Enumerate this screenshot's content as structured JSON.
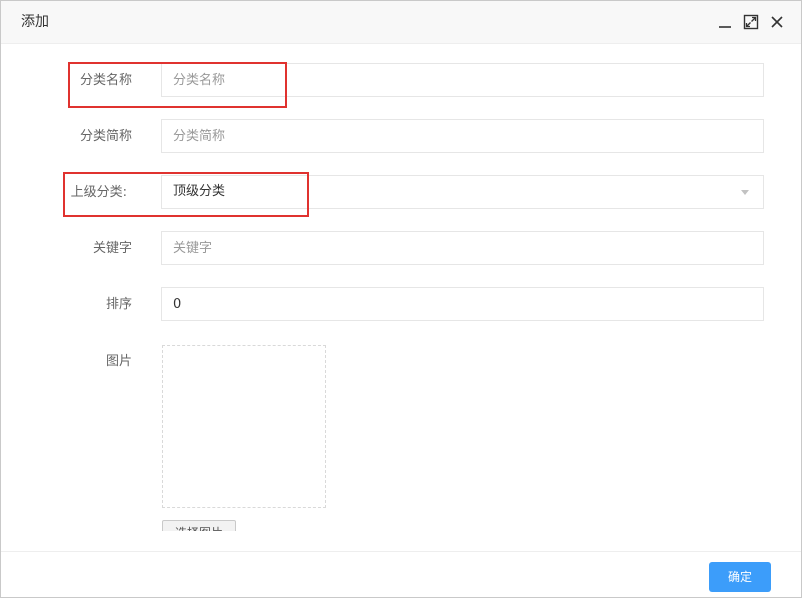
{
  "dialog": {
    "title": "添加"
  },
  "form": {
    "name": {
      "label": "分类名称",
      "placeholder": "分类名称"
    },
    "short_name": {
      "label": "分类简称",
      "placeholder": "分类简称"
    },
    "parent": {
      "label": "上级分类:",
      "value": "顶级分类"
    },
    "keywords": {
      "label": "关键字",
      "placeholder": "关键字"
    },
    "sort": {
      "label": "排序",
      "value": "0"
    },
    "image": {
      "label": "图片",
      "button_label": "选择图片"
    }
  },
  "footer": {
    "confirm_label": "确定"
  },
  "colors": {
    "accent": "#3c9dfa",
    "highlight": "#e0322f"
  }
}
